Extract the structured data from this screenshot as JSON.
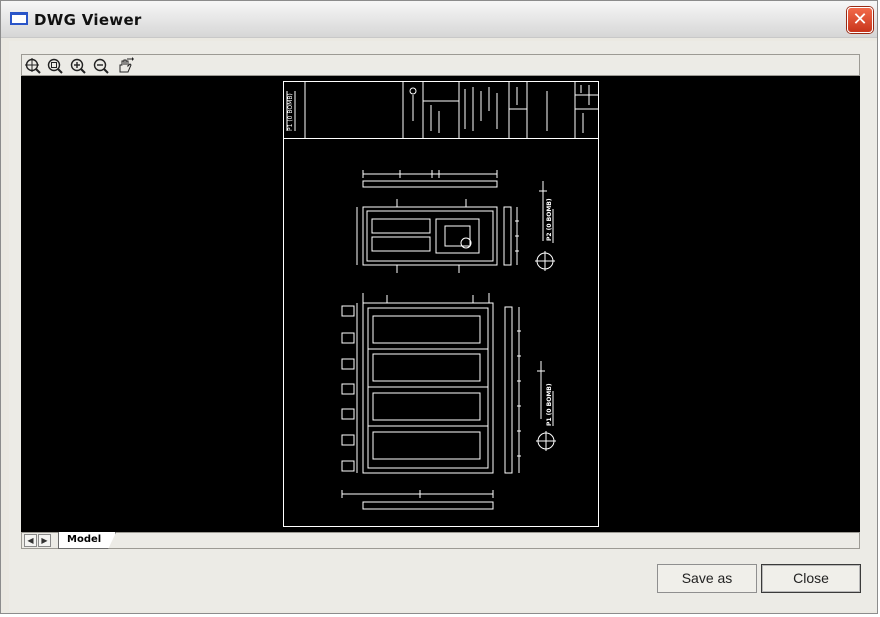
{
  "window": {
    "title": "DWG Viewer",
    "close_glyph": "✕"
  },
  "toolbar": {
    "tools": [
      {
        "name": "zoom-window-icon"
      },
      {
        "name": "zoom-extents-icon"
      },
      {
        "name": "zoom-in-icon"
      },
      {
        "name": "zoom-out-icon"
      },
      {
        "name": "pan-icon"
      }
    ]
  },
  "layout_tabs": {
    "prev_glyph": "◀",
    "next_glyph": "▶",
    "active": "Model"
  },
  "buttons": {
    "save_as": "Save as",
    "close": "Close"
  },
  "drawing": {
    "title_block_left": "P1 (0 BOMB)",
    "upper_label": "P2 (0 BOMB)",
    "lower_label": "P1 (0 BOMB)"
  },
  "colors": {
    "canvas": "#000000",
    "lines": "#ffffff",
    "close_button": "#d9472b",
    "title_icon": "#2a55c8"
  }
}
